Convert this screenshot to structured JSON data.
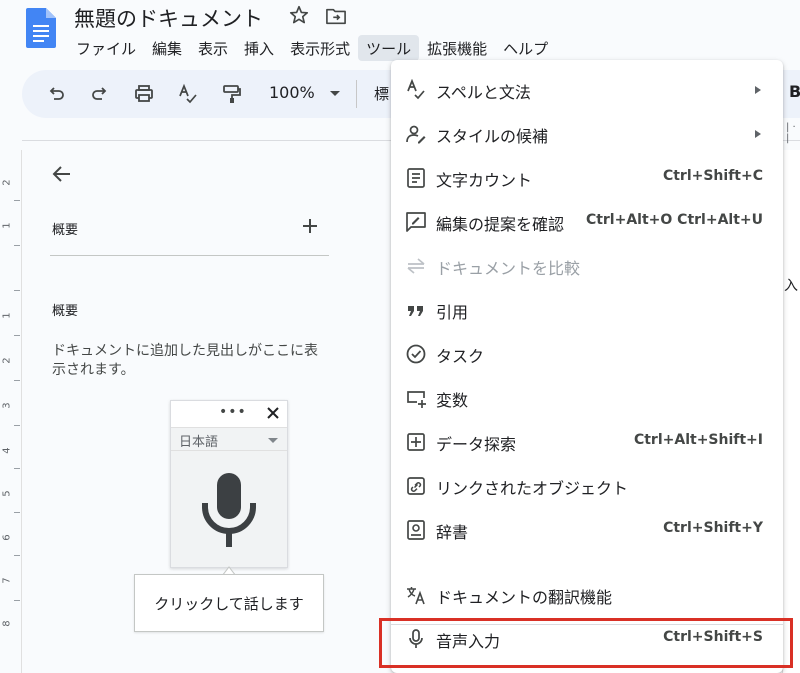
{
  "app": {
    "title": "無題のドキュメント",
    "brand_color": "#4285f4"
  },
  "menubar": {
    "items": [
      {
        "label": "ファイル"
      },
      {
        "label": "編集"
      },
      {
        "label": "表示"
      },
      {
        "label": "挿入"
      },
      {
        "label": "表示形式"
      },
      {
        "label": "ツール",
        "active": true
      },
      {
        "label": "拡張機能"
      },
      {
        "label": "ヘルプ"
      }
    ]
  },
  "toolbar": {
    "zoom": "100%",
    "style_partial": "標",
    "bold_partial": "B",
    "icons": [
      "undo-icon",
      "redo-icon",
      "print-icon",
      "spellcheck-icon",
      "paint-format-icon"
    ]
  },
  "ruler": {
    "numbers": [
      "2",
      "1",
      "1",
      "2",
      "3",
      "4",
      "5",
      "6",
      "7",
      "8"
    ]
  },
  "outline": {
    "section_label": "概要",
    "summary_label": "概要",
    "summary_text": "ドキュメントに追加した見出しがここに表示されます。"
  },
  "voice_widget": {
    "dots": "•••",
    "language": "日本語",
    "tooltip": "クリックして話します",
    "mic_color": "#3c4043"
  },
  "page_edge": {
    "text": "入"
  },
  "tools_menu": {
    "items": [
      {
        "icon": "spellcheck-icon",
        "label": "スペルと文法",
        "shortcut": "",
        "submenu": true,
        "disabled": false
      },
      {
        "icon": "style-suggestion-icon",
        "label": "スタイルの候補",
        "shortcut": "",
        "submenu": true,
        "disabled": false
      },
      {
        "icon": "word-count-icon",
        "label": "文字カウント",
        "shortcut": "Ctrl+Shift+C",
        "submenu": false,
        "disabled": false
      },
      {
        "icon": "review-edits-icon",
        "label": "編集の提案を確認",
        "shortcut": "Ctrl+Alt+O Ctrl+Alt+U",
        "submenu": false,
        "disabled": false
      },
      {
        "icon": "compare-documents-icon",
        "label": "ドキュメントを比較",
        "shortcut": "",
        "submenu": false,
        "disabled": true
      },
      {
        "icon": "citations-icon",
        "label": "引用",
        "shortcut": "",
        "submenu": false,
        "disabled": false
      },
      {
        "icon": "tasks-icon",
        "label": "タスク",
        "shortcut": "",
        "submenu": false,
        "disabled": false
      },
      {
        "icon": "variables-icon",
        "label": "変数",
        "shortcut": "",
        "submenu": false,
        "disabled": false
      },
      {
        "icon": "explore-icon",
        "label": "データ探索",
        "shortcut": "Ctrl+Alt+Shift+I",
        "submenu": false,
        "disabled": false
      },
      {
        "icon": "linked-objects-icon",
        "label": "リンクされたオブジェクト",
        "shortcut": "",
        "submenu": false,
        "disabled": false
      },
      {
        "icon": "dictionary-icon",
        "label": "辞書",
        "shortcut": "Ctrl+Shift+Y",
        "submenu": false,
        "disabled": false
      },
      {
        "icon": "translate-icon",
        "label": "ドキュメントの翻訳機能",
        "shortcut": "",
        "submenu": false,
        "disabled": false
      },
      {
        "icon": "mic-icon",
        "label": "音声入力",
        "shortcut": "Ctrl+Shift+S",
        "submenu": false,
        "disabled": false
      }
    ]
  },
  "highlight_color": "#d93025"
}
